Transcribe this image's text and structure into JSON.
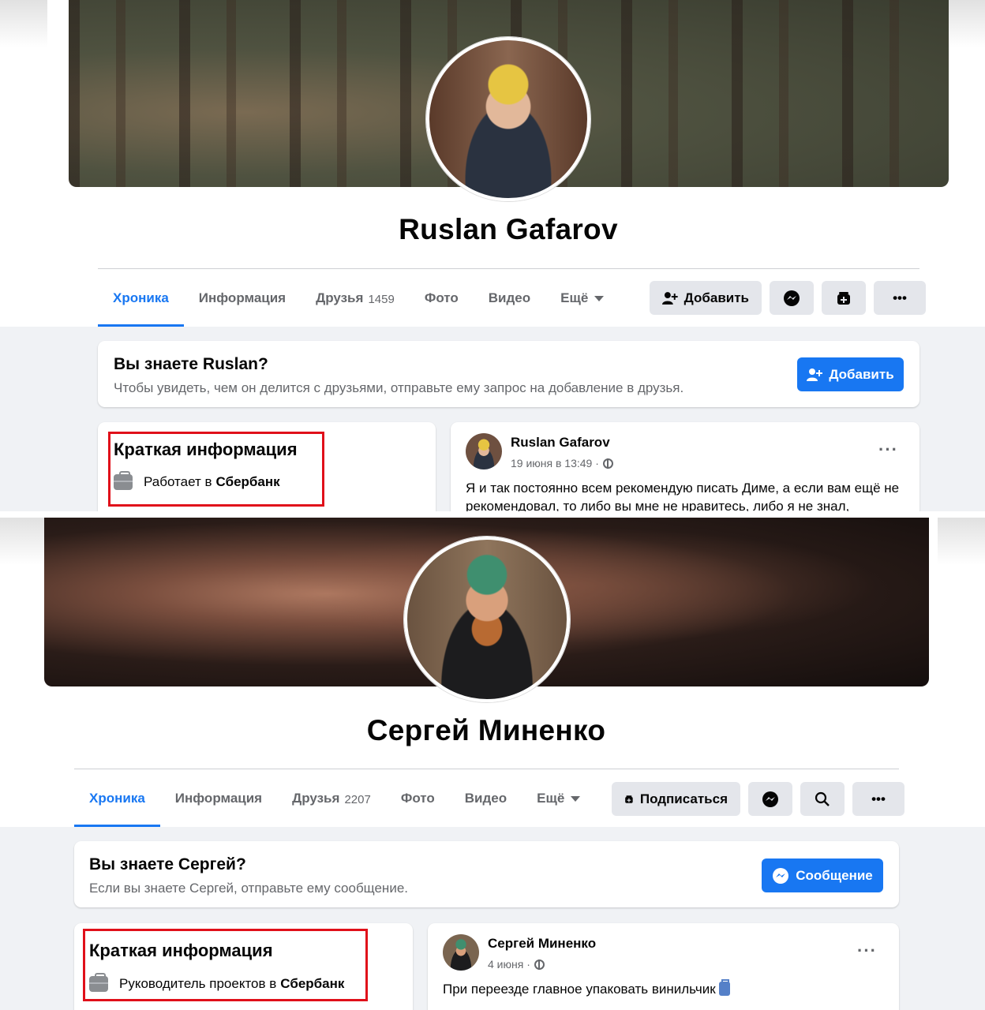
{
  "profiles": [
    {
      "name": "Ruslan Gafarov",
      "tabs": [
        {
          "label": "Хроника"
        },
        {
          "label": "Информация"
        },
        {
          "label": "Друзья",
          "count": "1459"
        },
        {
          "label": "Фото"
        },
        {
          "label": "Видео"
        },
        {
          "label": "Ещё"
        }
      ],
      "actions": {
        "primary_label": "Добавить",
        "primary_icon": "add-friend-icon"
      },
      "know_card": {
        "title": "Вы знаете Ruslan?",
        "subtitle": "Чтобы увидеть, чем он делится с друзьями, отправьте ему запрос на добавление в друзья.",
        "button_label": "Добавить",
        "button_icon": "add-friend-icon"
      },
      "brief": {
        "title": "Краткая информация",
        "work_prefix": "Работает в",
        "work_company": "Сбербанк"
      },
      "post": {
        "author": "Ruslan Gafarov",
        "time": "19 июня в 13:49 ·",
        "text": "Я и так постоянно всем рекомендую писать Диме, а если вам ещё не рекомендовал, то либо вы мне не нравитесь, либо я не знал,"
      }
    },
    {
      "name": "Сергей Миненко",
      "tabs": [
        {
          "label": "Хроника"
        },
        {
          "label": "Информация"
        },
        {
          "label": "Друзья",
          "count": "2207"
        },
        {
          "label": "Фото"
        },
        {
          "label": "Видео"
        },
        {
          "label": "Ещё"
        }
      ],
      "actions": {
        "primary_label": "Подписаться",
        "primary_icon": "follow-icon"
      },
      "know_card": {
        "title": "Вы знаете Сергей?",
        "subtitle": "Если вы знаете Сергей, отправьте ему сообщение.",
        "button_label": "Сообщение",
        "button_icon": "messenger-icon"
      },
      "brief": {
        "title": "Краткая информация",
        "work_prefix": "Руководитель проектов в",
        "work_company": "Сбербанк"
      },
      "post": {
        "author": "Сергей Миненко",
        "time": "4 июня ·",
        "text": "При переезде главное упаковать винильчик"
      }
    }
  ],
  "colors": {
    "accent": "#1877f2",
    "highlight": "#e0101a",
    "page_bg": "#f0f2f5",
    "button_bg": "#e4e6eb",
    "muted_text": "#65676b"
  }
}
